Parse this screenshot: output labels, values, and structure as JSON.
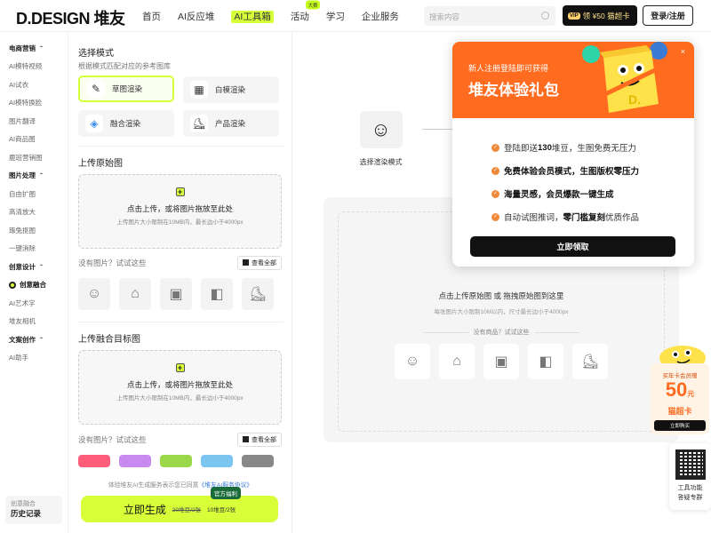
{
  "header": {
    "logo": "D.DESIGN 堆友",
    "nav": [
      {
        "label": "首页"
      },
      {
        "label": "AI反应堆"
      },
      {
        "label": "AI工具箱",
        "active": true
      },
      {
        "label": "活动",
        "badge": "大赛"
      },
      {
        "label": "学习"
      },
      {
        "label": "企业服务"
      }
    ],
    "search_placeholder": "搜索内容",
    "vip": {
      "tag": "VIP",
      "label": "领 ¥50 猫超卡"
    },
    "login": "登录/注册"
  },
  "sidebar": {
    "groups": [
      {
        "title": "电商营销",
        "items": [
          "AI模特视频",
          "AI试衣",
          "AI模特换脸",
          "图片翻译",
          "AI商品图",
          "鹿班营销图"
        ]
      },
      {
        "title": "图片处理",
        "items": [
          "自由扩图",
          "高清放大",
          "琢兔抠图",
          "一键消除"
        ]
      },
      {
        "title": "创意设计",
        "items": [
          "创意融合",
          "AI艺术字",
          "堆友相机"
        ]
      },
      {
        "title": "文案创作",
        "items": [
          "AI助手"
        ]
      }
    ],
    "active_item": "创意融合",
    "history": {
      "sub": "创意融合",
      "title": "历史记录"
    }
  },
  "panel": {
    "mode_title": "选择模式",
    "mode_sub": "根据模式匹配对应的参考图库",
    "modes": [
      "草图渲染",
      "白模渲染",
      "融合渲染",
      "产品渲染"
    ],
    "upload1_title": "上传原始图",
    "upload_text": "点击上传，或将图片拖放至此处",
    "upload_hint": "上传图片大小限制在10MB内，最长边小于4000px",
    "try_label": "没有图片？试试这些",
    "view_all": "查看全部",
    "upload2_title": "上传融合目标图",
    "agree_text": "体验堆友AI生成服务表示您已同意",
    "agree_link": "《堆友AI服务协议》",
    "generate": {
      "label": "立即生成",
      "old_price": "20堆豆/2张",
      "price": "10堆豆/2张",
      "tag": "官方福利"
    }
  },
  "main": {
    "step_label": "选择渲染模式",
    "drop_title": "点击上传原始图 或 拖拽原始图到这里",
    "drop_hint": "每张图片大小限制10M以内，尺寸最长边小于4000px",
    "drop_try": "没有商品？试试这些"
  },
  "popup": {
    "sub": "新人注册登陆即可获得",
    "title": "堆友体验礼包",
    "close": "×",
    "items": [
      {
        "pre": "登陆即送",
        "bold": "130",
        "post": "堆豆，生图免费无压力"
      },
      {
        "pre": "",
        "bold": "免费体验会员模式，生图版权零压力",
        "post": ""
      },
      {
        "pre": "",
        "bold": "海量灵感，会员爆款一键生成",
        "post": ""
      },
      {
        "pre": "自动试图推词，",
        "bold": "零门槛复刻",
        "post": "优质作品"
      }
    ],
    "cta": "立即领取"
  },
  "promo": {
    "line1": "买年卡会员赠",
    "amount": "50",
    "unit": "元",
    "card": "猫超卡",
    "btn": "立即购买"
  },
  "qr": {
    "line1": "工具功能",
    "line2": "答疑专群"
  },
  "colors": {
    "accent": "#d6ff3a",
    "popup_header": "#ff6b1f",
    "dark": "#111111"
  }
}
